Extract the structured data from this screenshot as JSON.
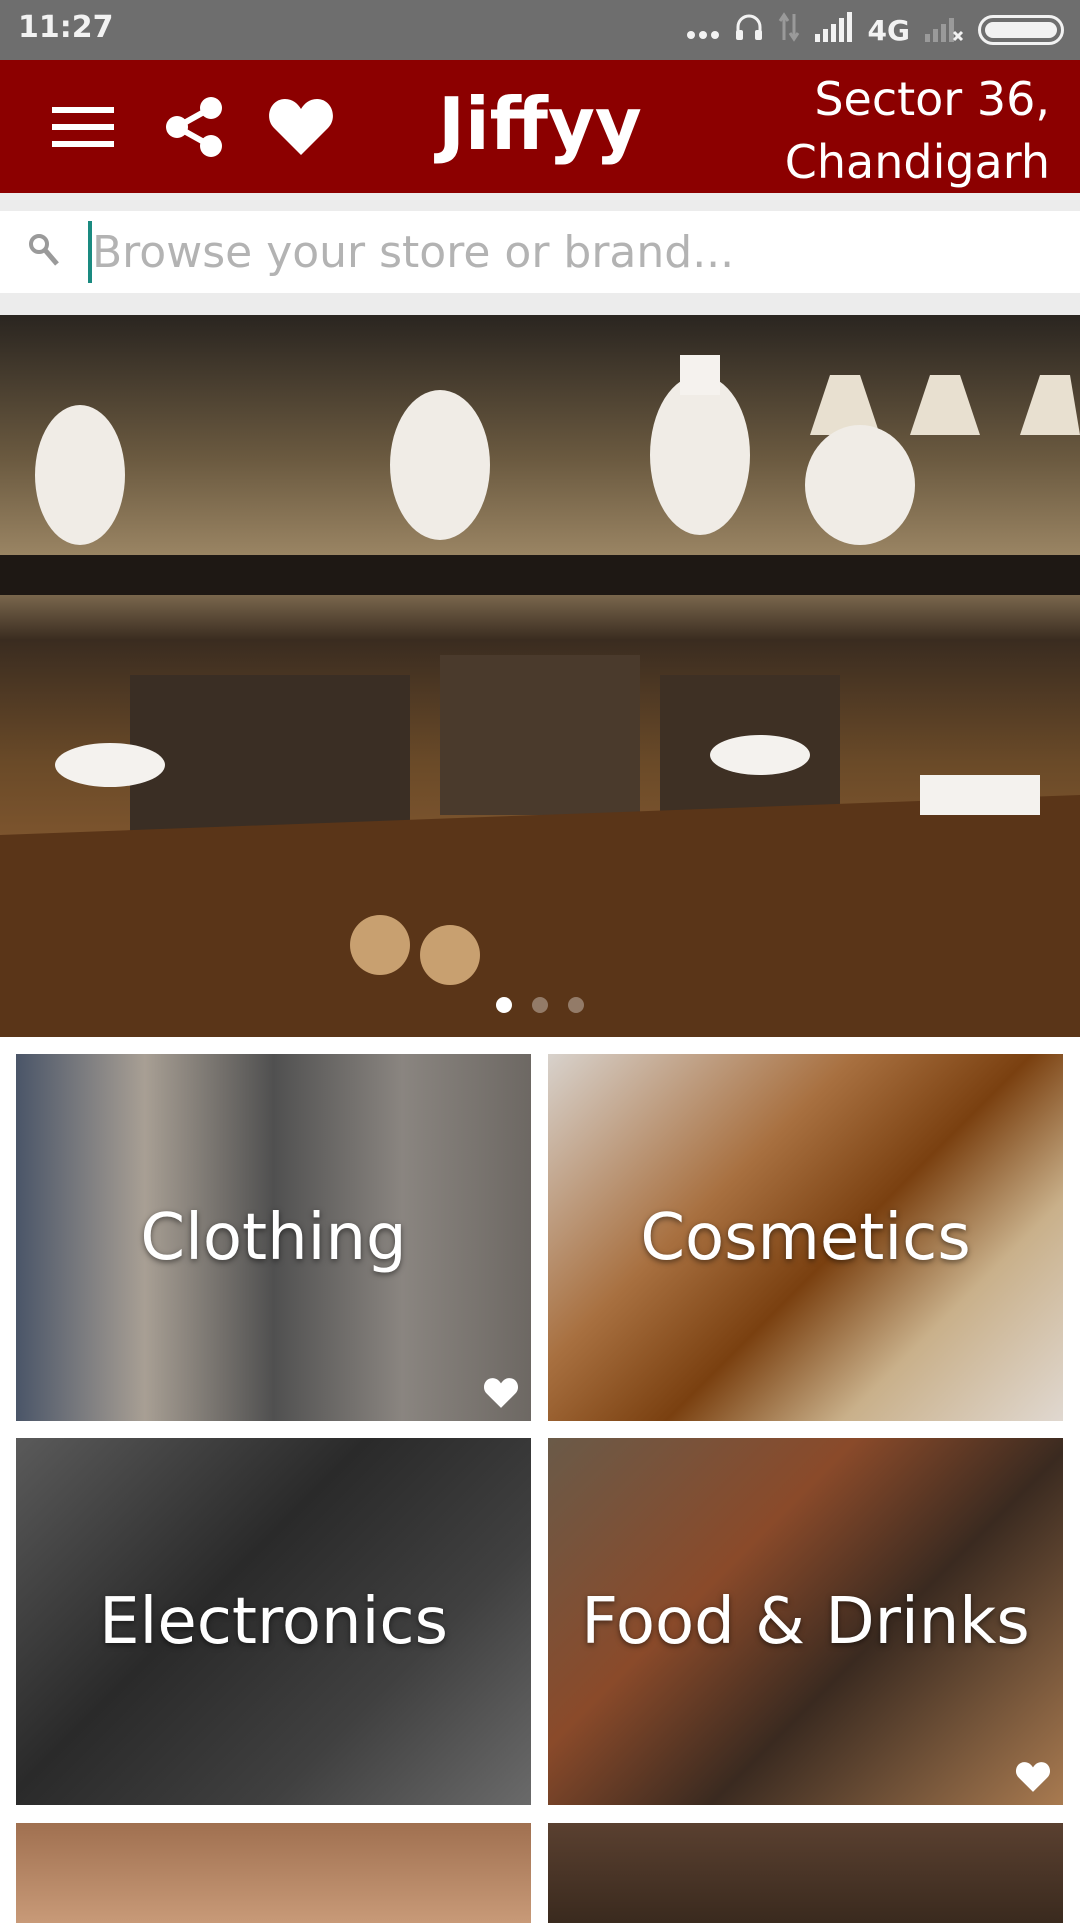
{
  "status_bar": {
    "time": "11:27",
    "network": "4G",
    "icons": [
      "more-dots-icon",
      "headphones-icon",
      "data-arrows-icon",
      "signal-icon",
      "signal-no-sim-icon",
      "battery-icon"
    ]
  },
  "app_bar": {
    "title": "Jiffyy",
    "location_line1": "Sector 36,",
    "location_line2": "Chandigarh",
    "icons": [
      "menu-icon",
      "share-icon",
      "heart-icon"
    ],
    "color": "#8c0000"
  },
  "search": {
    "placeholder": "Browse your store or brand...",
    "value": "",
    "icon": "search-icon",
    "cursor_color": "#1a8a80"
  },
  "banner": {
    "image": "restaurant kitchen photo",
    "dot_count": 3,
    "active_index": 0
  },
  "categories": [
    {
      "label": "Clothing",
      "favorited": true
    },
    {
      "label": "Cosmetics",
      "favorited": false
    },
    {
      "label": "Electronics",
      "favorited": false
    },
    {
      "label": "Food & Drinks",
      "favorited": true
    }
  ]
}
